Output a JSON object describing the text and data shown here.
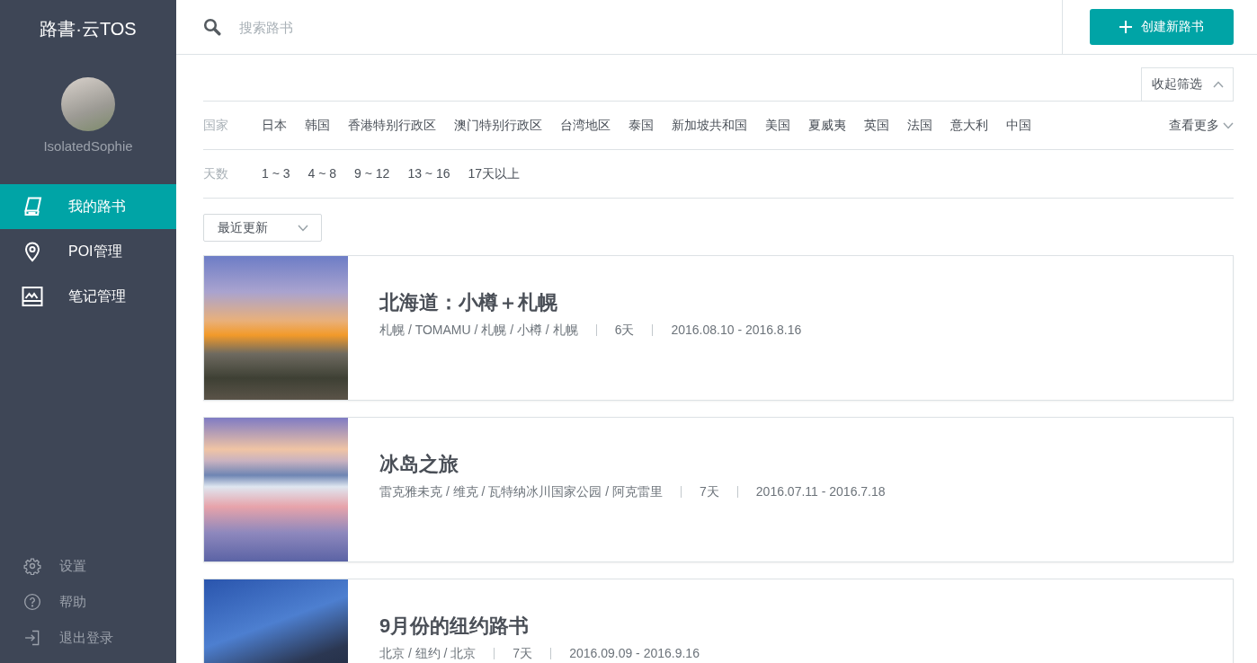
{
  "sidebar": {
    "logo": "路書·云TOS",
    "user": {
      "name": "IsolatedSophie"
    },
    "nav": [
      {
        "label": "我的路书",
        "selected": true
      },
      {
        "label": "POI管理",
        "selected": false
      },
      {
        "label": "笔记管理",
        "selected": false
      }
    ],
    "footer": [
      "设置",
      "帮助",
      "退出登录"
    ]
  },
  "top_bar": {
    "search": {
      "placeholder": "搜索路书"
    },
    "create_button": "创建新路书"
  },
  "filters": {
    "collapse_button": "收起筛选",
    "groups": [
      {
        "label": "国家",
        "options": [
          {
            "label": "日本",
            "selected": false
          },
          {
            "label": "韩国",
            "selected": false
          },
          {
            "label": "香港特别行政区",
            "selected": false
          },
          {
            "label": "澳门特别行政区",
            "selected": false
          },
          {
            "label": "台湾地区",
            "selected": false
          },
          {
            "label": "泰国",
            "selected": false
          },
          {
            "label": "新加坡共和国",
            "selected": false
          },
          {
            "label": "美国",
            "selected": false
          },
          {
            "label": "夏威夷",
            "selected": false
          },
          {
            "label": "英国",
            "selected": false
          },
          {
            "label": "法国",
            "selected": false
          },
          {
            "label": "意大利",
            "selected": false
          },
          {
            "label": "中国",
            "selected": false
          }
        ],
        "more": "查看更多"
      },
      {
        "label": "天数",
        "options": [
          {
            "label": "1 ~ 3",
            "selected": false
          },
          {
            "label": "4 ~ 8",
            "selected": false
          },
          {
            "label": "9 ~ 12",
            "selected": false
          },
          {
            "label": "13 ~ 16",
            "selected": false
          },
          {
            "label": "17天以上",
            "selected": false
          }
        ]
      }
    ]
  },
  "sort": {
    "value": "最近更新"
  },
  "trips": [
    {
      "title": "北海道：小樽＋札幌",
      "route": "札幌 / TOMAMU / 札幌 / 小樽 / 札幌",
      "days": "6天",
      "dates": "2016.08.10 - 2016.8.16"
    },
    {
      "title": "冰岛之旅",
      "route": "雷克雅未克 / 维克 / 瓦特纳冰川国家公园 / 阿克雷里",
      "days": "7天",
      "dates": "2016.07.11 - 2016.7.18"
    },
    {
      "title": "9月份的纽约路书",
      "route": "北京 / 纽约 / 北京",
      "days": "7天",
      "dates": "2016.09.09 - 2016.9.16"
    }
  ]
}
